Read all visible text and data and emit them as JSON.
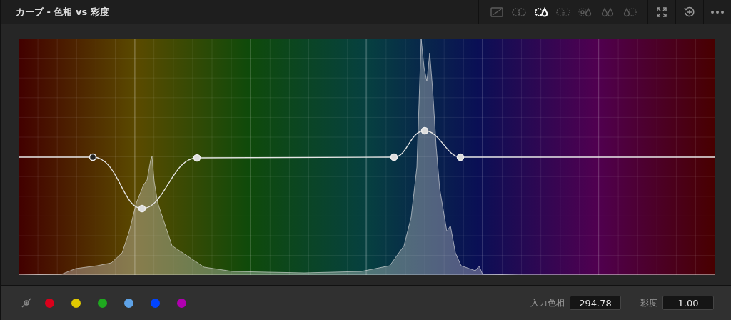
{
  "panel": {
    "title": "カーブ - 色相 vs 彩度"
  },
  "tools": [
    {
      "kind": "curve",
      "selected": false
    },
    {
      "kind": "ring",
      "selected": false
    },
    {
      "kind": "ring-drop",
      "selected": true
    },
    {
      "kind": "ring-sparse",
      "selected": false
    },
    {
      "kind": "sun-drop",
      "selected": false
    },
    {
      "kind": "drops",
      "selected": false
    },
    {
      "kind": "drop-sun",
      "selected": false
    }
  ],
  "swatches": [
    {
      "color": "#d9001b"
    },
    {
      "color": "#e0c800"
    },
    {
      "color": "#1fa81f"
    },
    {
      "color": "#5ea2e6"
    },
    {
      "color": "#0044ff"
    },
    {
      "color": "#b000b0"
    }
  ],
  "fields": [
    {
      "label": "入力色相",
      "value": "294.78"
    },
    {
      "label": "彩度",
      "value": "1.00"
    }
  ]
}
